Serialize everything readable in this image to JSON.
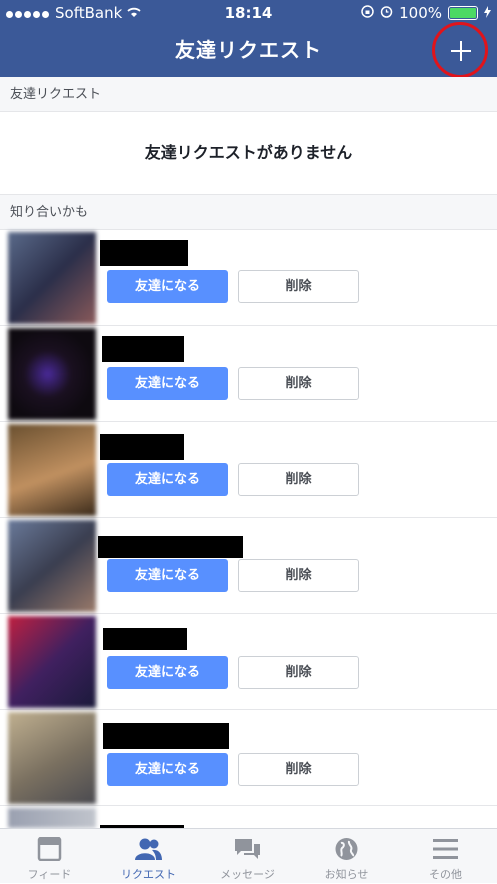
{
  "status_bar": {
    "carrier": "SoftBank",
    "time": "18:14",
    "battery": "100%"
  },
  "header": {
    "title": "友達リクエスト"
  },
  "requests_section": {
    "label": "友達リクエスト",
    "empty_message": "友達リクエストがありません"
  },
  "suggestions_section": {
    "label": "知り合いかも"
  },
  "suggestions": [
    {
      "add_label": "友達になる",
      "delete_label": "削除"
    },
    {
      "add_label": "友達になる",
      "delete_label": "削除"
    },
    {
      "add_label": "友達になる",
      "delete_label": "削除"
    },
    {
      "add_label": "友達になる",
      "delete_label": "削除"
    },
    {
      "add_label": "友達になる",
      "delete_label": "削除"
    },
    {
      "add_label": "友達になる",
      "delete_label": "削除"
    }
  ],
  "tabs": [
    {
      "label": "フィード",
      "icon": "feed-icon"
    },
    {
      "label": "リクエスト",
      "icon": "friends-icon"
    },
    {
      "label": "メッセージ",
      "icon": "message-icon"
    },
    {
      "label": "お知らせ",
      "icon": "globe-icon"
    },
    {
      "label": "その他",
      "icon": "menu-icon"
    }
  ],
  "colors": {
    "header": "#3b5998",
    "add_button": "#5890ff",
    "active_tab": "#4267b2",
    "highlight_circle": "#e0141b"
  }
}
